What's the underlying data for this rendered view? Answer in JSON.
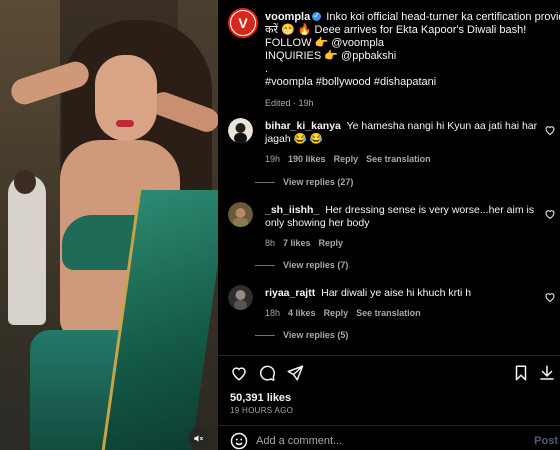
{
  "post": {
    "username": "voompla",
    "caption_lines": [
      "Inko koi official head-turner ka certification provide",
      "करें 😁 🔥 Deee arrives for Ekta Kapoor's Diwali bash!",
      "FOLLOW 👉 @voompla",
      "INQUIRIES 👉 @ppbakshi",
      ".",
      "#voompla #bollywood #dishapatani"
    ],
    "edited_label": "Edited · 19h"
  },
  "comments": [
    {
      "username": "bihar_ki_kanya",
      "text": "Ye hamesha nangi hi Kyun aa jati hai har jagah 😂 😂",
      "time": "19h",
      "likes": "190 likes",
      "reply_label": "Reply",
      "translation_label": "See translation",
      "view_replies": "View replies (27)"
    },
    {
      "username": "_sh_iishh_",
      "text": "Her dressing sense is very worse...her aim is only showing her body",
      "time": "8h",
      "likes": "7 likes",
      "reply_label": "Reply",
      "view_replies": "View replies (7)"
    },
    {
      "username": "riyaa_rajtt",
      "text": "Har diwali ye aise hi khuch krti h",
      "time": "18h",
      "likes": "4 likes",
      "reply_label": "Reply",
      "translation_label": "See translation",
      "view_replies": "View replies (5)"
    }
  ],
  "engagement": {
    "likes": "50,391 likes",
    "time_ago": "19 HOURS AGO"
  },
  "add_comment": {
    "placeholder": "Add a comment...",
    "post_label": "Post"
  },
  "colors": {
    "background": "#000000",
    "secondary_text": "#a8a8a8",
    "verified": "#3897f0",
    "brand_red": "#d3281c",
    "post_disabled": "#4e5b73"
  },
  "icons": [
    "heart-icon",
    "comment-icon",
    "share-icon",
    "bookmark-icon",
    "download-icon",
    "emoji-icon",
    "mute-icon",
    "verified-icon"
  ]
}
